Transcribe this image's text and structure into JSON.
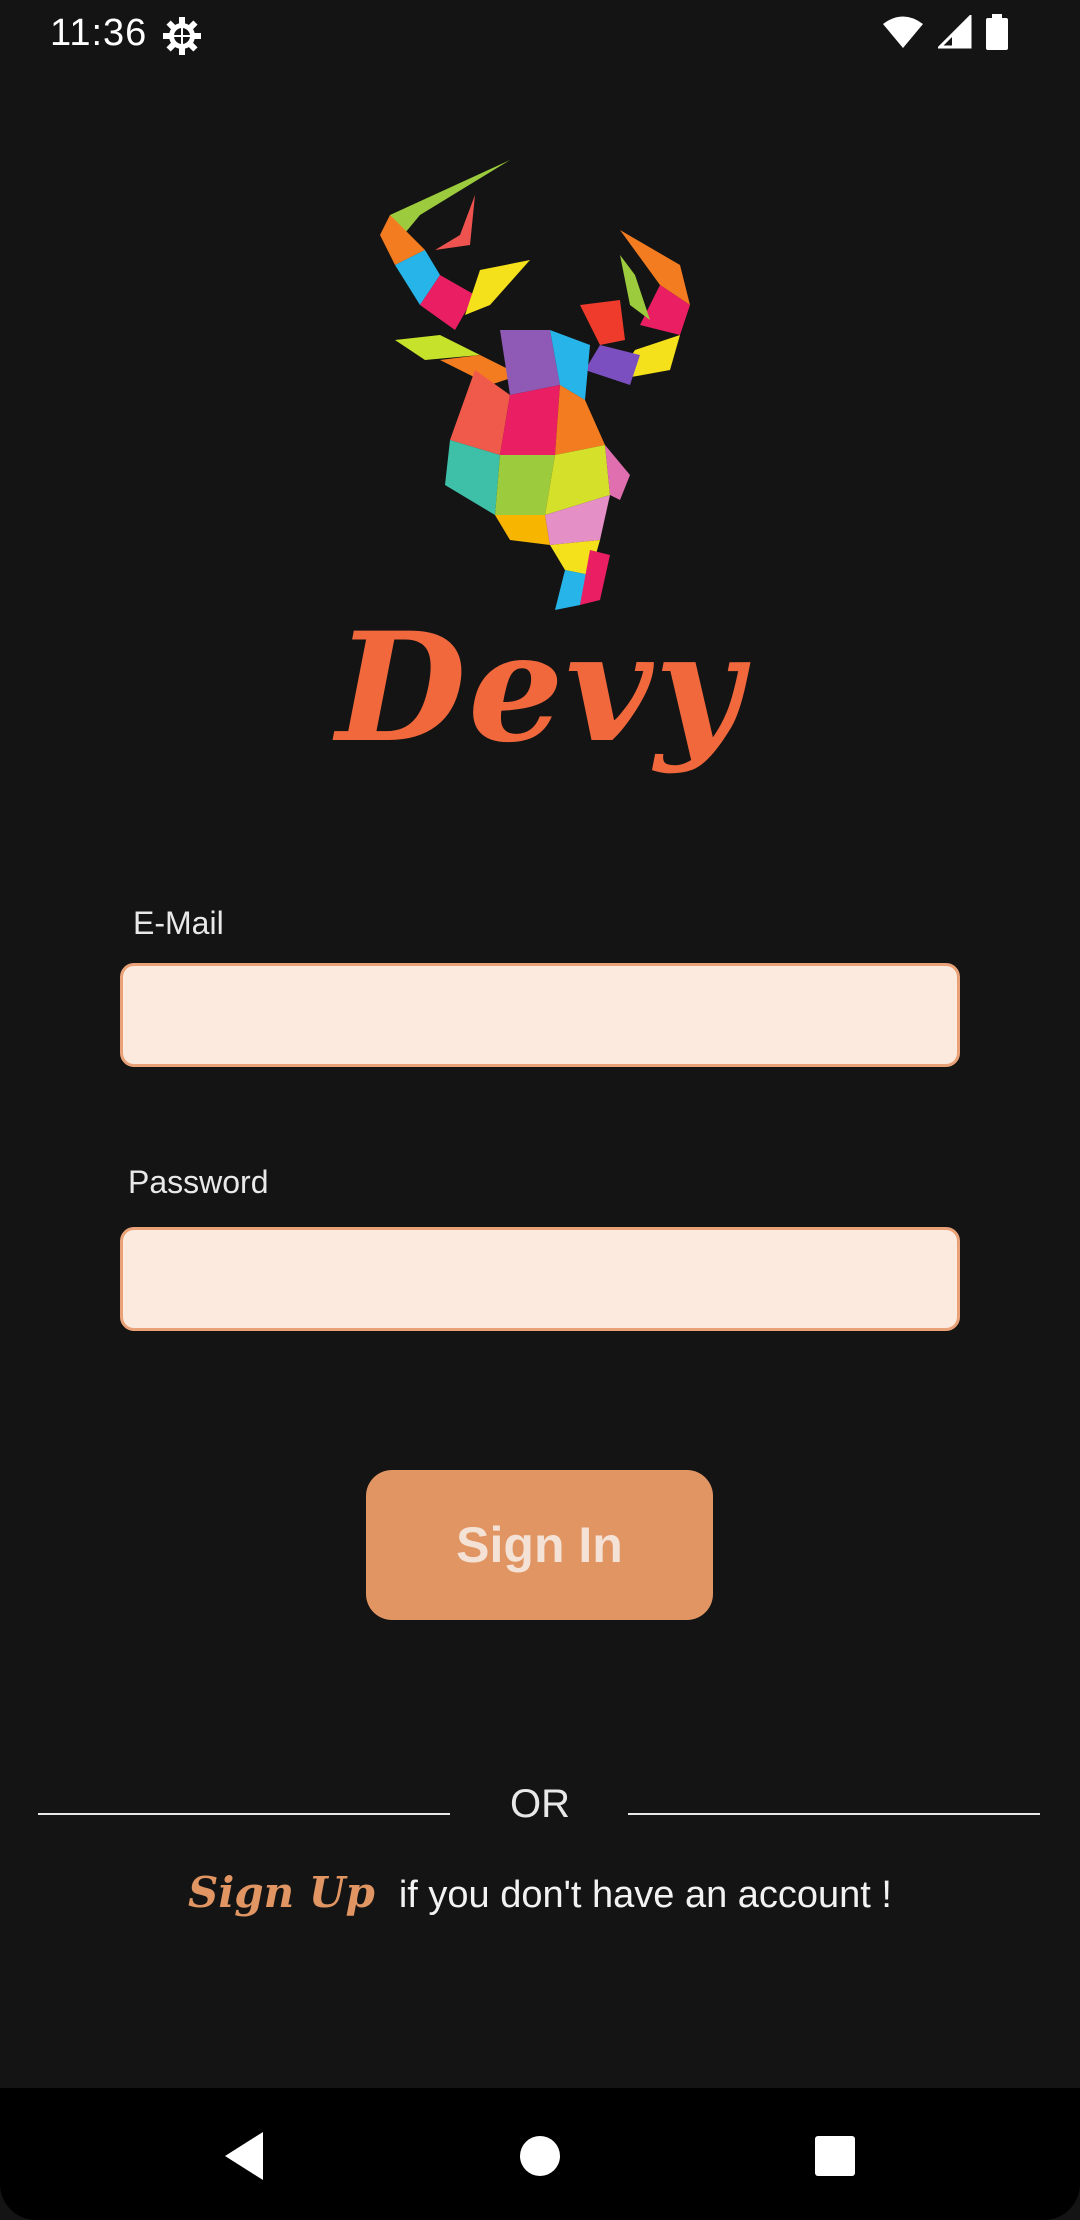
{
  "status_bar": {
    "time": "11:36",
    "icons": [
      "settings-gear-icon",
      "wifi-icon",
      "signal-icon",
      "battery-icon"
    ]
  },
  "brand": {
    "name": "Devy",
    "logo": "polygonal-deer-head-logo",
    "color": "#f1683d"
  },
  "form": {
    "email_label": "E-Mail",
    "email_value": "",
    "password_label": "Password",
    "password_value": ""
  },
  "actions": {
    "sign_in_label": "Sign In",
    "divider_text": "OR",
    "sign_up_link": "Sign Up",
    "sign_up_text": "if you don't have an account !"
  },
  "navigation_bar": {
    "buttons": [
      "back-icon",
      "home-icon",
      "recents-icon"
    ]
  },
  "colors": {
    "background": "#141414",
    "accent": "#e09562",
    "field_fill": "#fdeade",
    "field_border": "#e9a178"
  }
}
